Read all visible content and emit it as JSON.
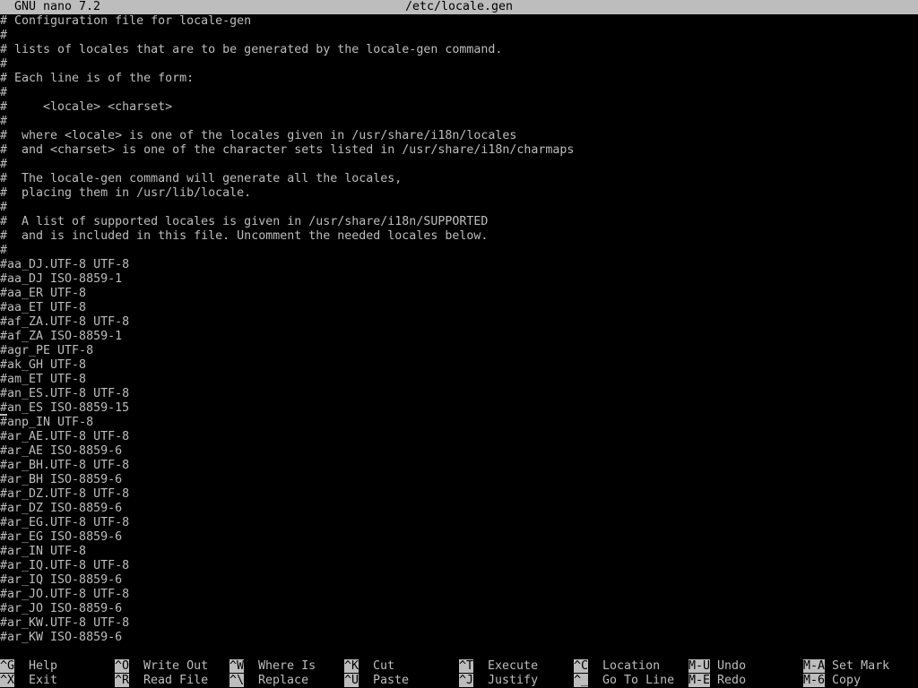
{
  "titlebar": {
    "app": "GNU nano 7.2",
    "file": "/etc/locale.gen"
  },
  "editor": {
    "lines": [
      "# Configuration file for locale-gen",
      "#",
      "# lists of locales that are to be generated by the locale-gen command.",
      "#",
      "# Each line is of the form:",
      "#",
      "#     <locale> <charset>",
      "#",
      "#  where <locale> is one of the locales given in /usr/share/i18n/locales",
      "#  and <charset> is one of the character sets listed in /usr/share/i18n/charmaps",
      "#",
      "#  The locale-gen command will generate all the locales,",
      "#  placing them in /usr/lib/locale.",
      "#",
      "#  A list of supported locales is given in /usr/share/i18n/SUPPORTED",
      "#  and is included in this file. Uncomment the needed locales below.",
      "#",
      "#aa_DJ.UTF-8 UTF-8",
      "#aa_DJ ISO-8859-1",
      "#aa_ER UTF-8",
      "#aa_ET UTF-8",
      "#af_ZA.UTF-8 UTF-8",
      "#af_ZA ISO-8859-1",
      "#agr_PE UTF-8",
      "#ak_GH UTF-8",
      "#am_ET UTF-8",
      "#an_ES.UTF-8 UTF-8",
      "#an_ES ISO-8859-15",
      "#anp_IN UTF-8",
      "#ar_AE.UTF-8 UTF-8",
      "#ar_AE ISO-8859-6",
      "#ar_BH.UTF-8 UTF-8",
      "#ar_BH ISO-8859-6",
      "#ar_DZ.UTF-8 UTF-8",
      "#ar_DZ ISO-8859-6",
      "#ar_EG.UTF-8 UTF-8",
      "#ar_EG ISO-8859-6",
      "#ar_IN UTF-8",
      "#ar_IQ.UTF-8 UTF-8",
      "#ar_IQ ISO-8859-6",
      "#ar_JO.UTF-8 UTF-8",
      "#ar_JO ISO-8859-6",
      "#ar_KW.UTF-8 UTF-8",
      "#ar_KW ISO-8859-6"
    ]
  },
  "shortcuts": [
    {
      "key": "^G",
      "label": "Help"
    },
    {
      "key": "^X",
      "label": "Exit"
    },
    {
      "key": "^O",
      "label": "Write Out"
    },
    {
      "key": "^R",
      "label": "Read File"
    },
    {
      "key": "^W",
      "label": "Where Is"
    },
    {
      "key": "^\\",
      "label": "Replace"
    },
    {
      "key": "^K",
      "label": "Cut"
    },
    {
      "key": "^U",
      "label": "Paste"
    },
    {
      "key": "^T",
      "label": "Execute"
    },
    {
      "key": "^J",
      "label": "Justify"
    },
    {
      "key": "^C",
      "label": "Location"
    },
    {
      "key": "^_",
      "label": "Go To Line"
    },
    {
      "key": "M-U",
      "label": "Undo"
    },
    {
      "key": "M-E",
      "label": "Redo"
    },
    {
      "key": "M-A",
      "label": "Set Mark"
    },
    {
      "key": "M-6",
      "label": "Copy"
    }
  ],
  "colors": {
    "background": "#000000",
    "foreground": "#bdbdbd",
    "inverse_text": "#000000"
  }
}
